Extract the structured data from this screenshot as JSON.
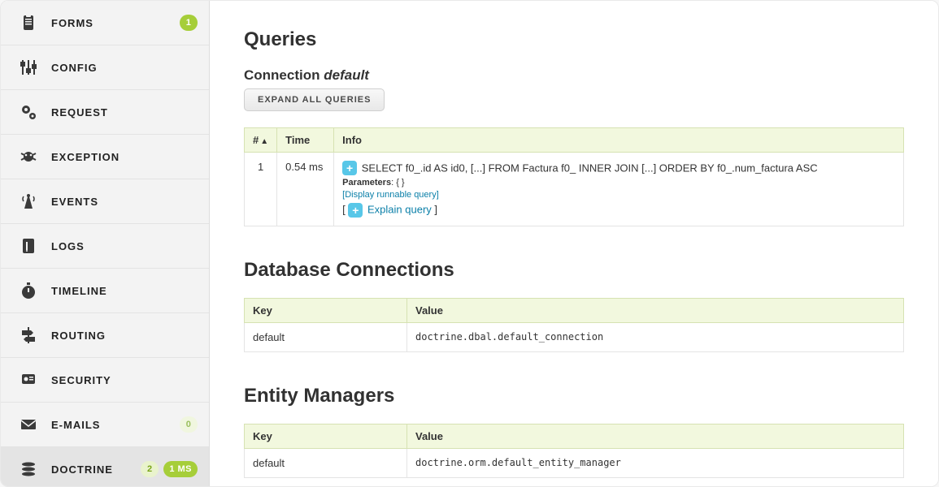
{
  "sidebar": {
    "items": [
      {
        "label": "FORMS",
        "icon": "clipboard-icon",
        "badges": [
          {
            "text": "1",
            "cls": ""
          }
        ]
      },
      {
        "label": "CONFIG",
        "icon": "sliders-icon",
        "badges": []
      },
      {
        "label": "REQUEST",
        "icon": "gears-icon",
        "badges": []
      },
      {
        "label": "EXCEPTION",
        "icon": "bug-icon",
        "badges": []
      },
      {
        "label": "EVENTS",
        "icon": "antenna-icon",
        "badges": []
      },
      {
        "label": "LOGS",
        "icon": "file-icon",
        "badges": []
      },
      {
        "label": "TIMELINE",
        "icon": "stopwatch-icon",
        "badges": []
      },
      {
        "label": "ROUTING",
        "icon": "sign-icon",
        "badges": []
      },
      {
        "label": "SECURITY",
        "icon": "badge-icon",
        "badges": []
      },
      {
        "label": "E-MAILS",
        "icon": "envelope-icon",
        "badges": [
          {
            "text": "0",
            "cls": "zeroish"
          }
        ]
      },
      {
        "label": "DOCTRINE",
        "icon": "stack-icon",
        "badges": [
          {
            "text": "2",
            "cls": "hollow"
          },
          {
            "text": "1 MS",
            "cls": ""
          }
        ],
        "active": true
      }
    ]
  },
  "queries": {
    "heading": "Queries",
    "connection_label": "Connection",
    "connection_name": "default",
    "expand_button": "EXPAND ALL QUERIES",
    "columns": {
      "num": "#",
      "time": "Time",
      "info": "Info"
    },
    "rows": [
      {
        "num": "1",
        "time": "0.54 ms",
        "sql": "SELECT f0_.id AS id0, [...] FROM Factura f0_ INNER JOIN [...] ORDER BY f0_.num_factura ASC",
        "params_label": "Parameters",
        "params_value": "{ }",
        "display_link": "[Display runnable query]",
        "explain_link": "Explain query"
      }
    ]
  },
  "db_connections": {
    "heading": "Database Connections",
    "columns": {
      "key": "Key",
      "value": "Value"
    },
    "rows": [
      {
        "key": "default",
        "value": "doctrine.dbal.default_connection"
      }
    ]
  },
  "entity_managers": {
    "heading": "Entity Managers",
    "columns": {
      "key": "Key",
      "value": "Value"
    },
    "rows": [
      {
        "key": "default",
        "value": "doctrine.orm.default_entity_manager"
      }
    ]
  }
}
